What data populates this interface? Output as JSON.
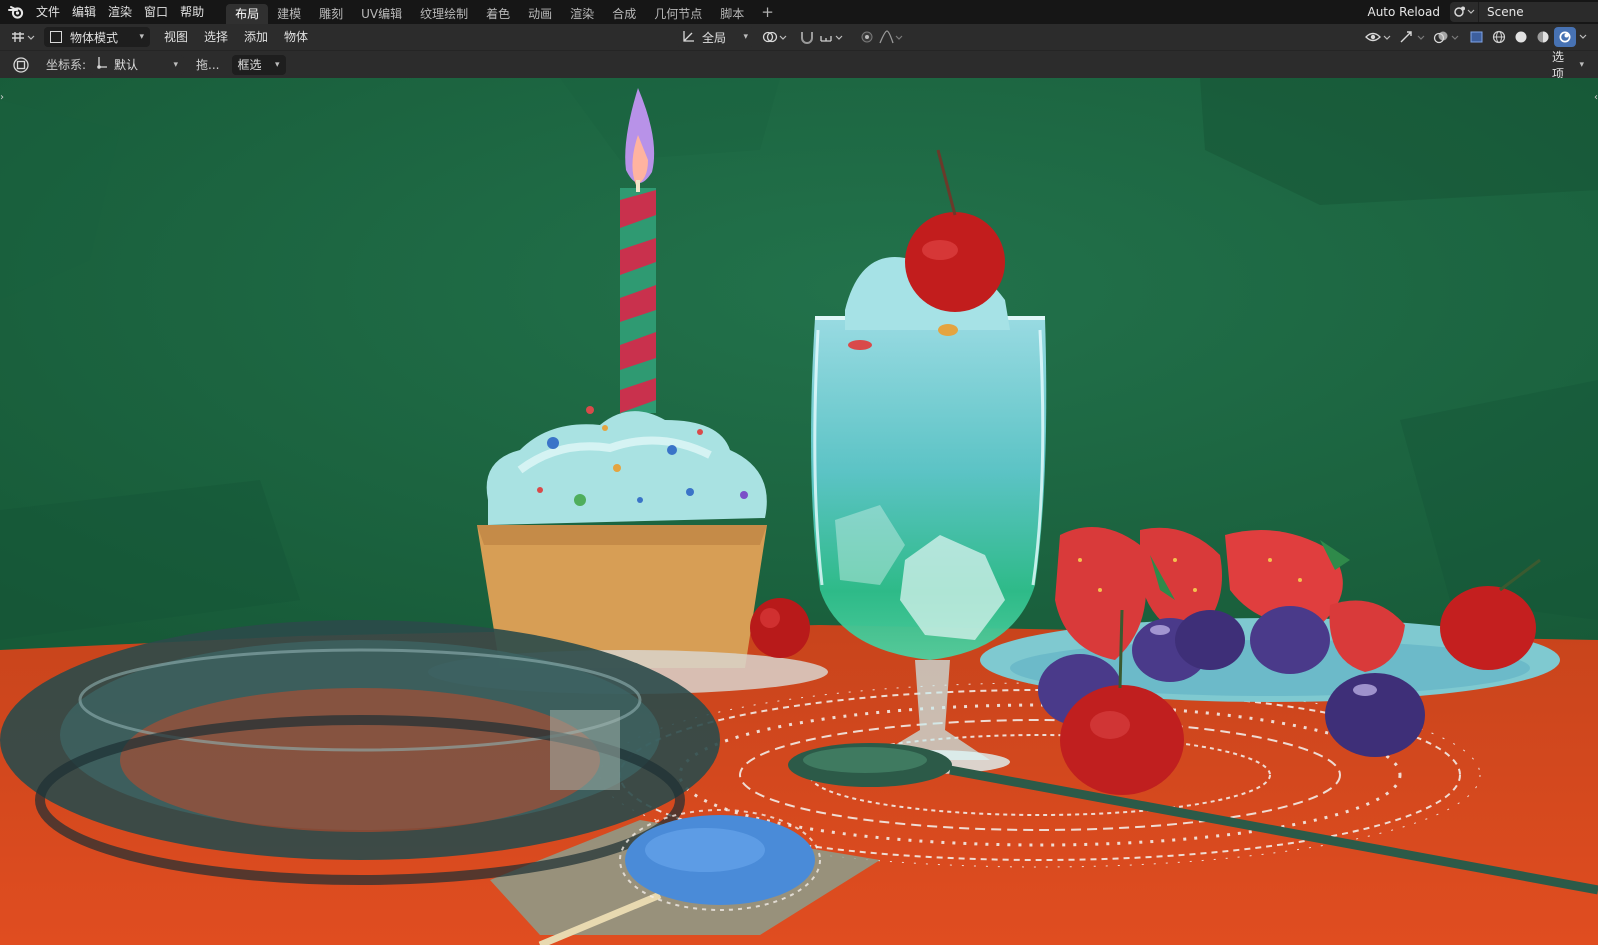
{
  "menu": {
    "items": [
      "文件",
      "编辑",
      "渲染",
      "窗口",
      "帮助"
    ]
  },
  "workspaces": {
    "tabs": [
      "布局",
      "建模",
      "雕刻",
      "UV编辑",
      "纹理绘制",
      "着色",
      "动画",
      "渲染",
      "合成",
      "几何节点",
      "脚本"
    ],
    "active_index": 0
  },
  "topright": {
    "auto_reload": "Auto Reload",
    "scene": "Scene"
  },
  "header": {
    "mode": "物体模式",
    "menus": [
      "视图",
      "选择",
      "添加",
      "物体"
    ],
    "transform_orientation": "全局"
  },
  "toolbar": {
    "coord_label": "坐标系:",
    "coord_value": "默认",
    "drag_label": "拖...",
    "select_mode": "框选",
    "options": "选项"
  },
  "colors": {
    "wall": "#1f6a45",
    "table": "#d8491e",
    "accent_blue": "#4a8bd8"
  }
}
